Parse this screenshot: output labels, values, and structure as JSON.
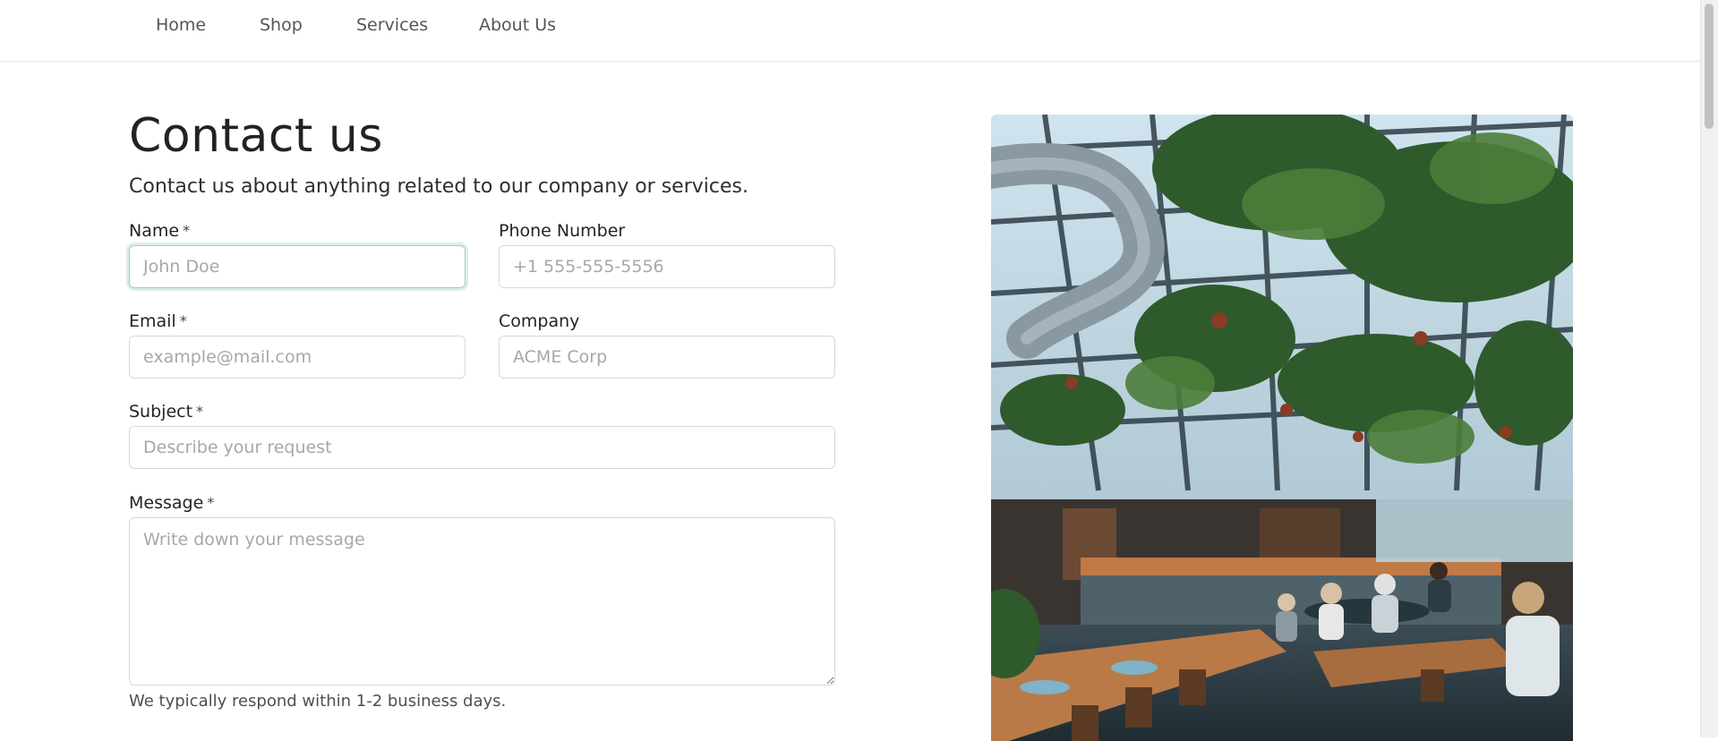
{
  "nav": {
    "items": [
      {
        "label": "Home"
      },
      {
        "label": "Shop"
      },
      {
        "label": "Services"
      },
      {
        "label": "About Us"
      }
    ]
  },
  "contact": {
    "title": "Contact us",
    "subtitle": "Contact us about anything related to our company or services.",
    "required_mark": "*",
    "fields": {
      "name": {
        "label": "Name",
        "placeholder": "John Doe",
        "value": ""
      },
      "phone": {
        "label": "Phone Number",
        "placeholder": "+1 555-555-5556",
        "value": ""
      },
      "email": {
        "label": "Email",
        "placeholder": "example@mail.com",
        "value": ""
      },
      "company": {
        "label": "Company",
        "placeholder": "ACME Corp",
        "value": ""
      },
      "subject": {
        "label": "Subject",
        "placeholder": "Describe your request",
        "value": ""
      },
      "message": {
        "label": "Message",
        "placeholder": "Write down your message",
        "value": ""
      }
    },
    "response_hint": "We typically respond within 1-2 business days."
  },
  "image": {
    "subject": "greenhouse cafe interior with hanging plants"
  },
  "colors": {
    "focus_border": "#9fd0bf",
    "focus_ring": "#dcefe6",
    "input_border": "#d6d9dc",
    "text": "#1f2326"
  }
}
